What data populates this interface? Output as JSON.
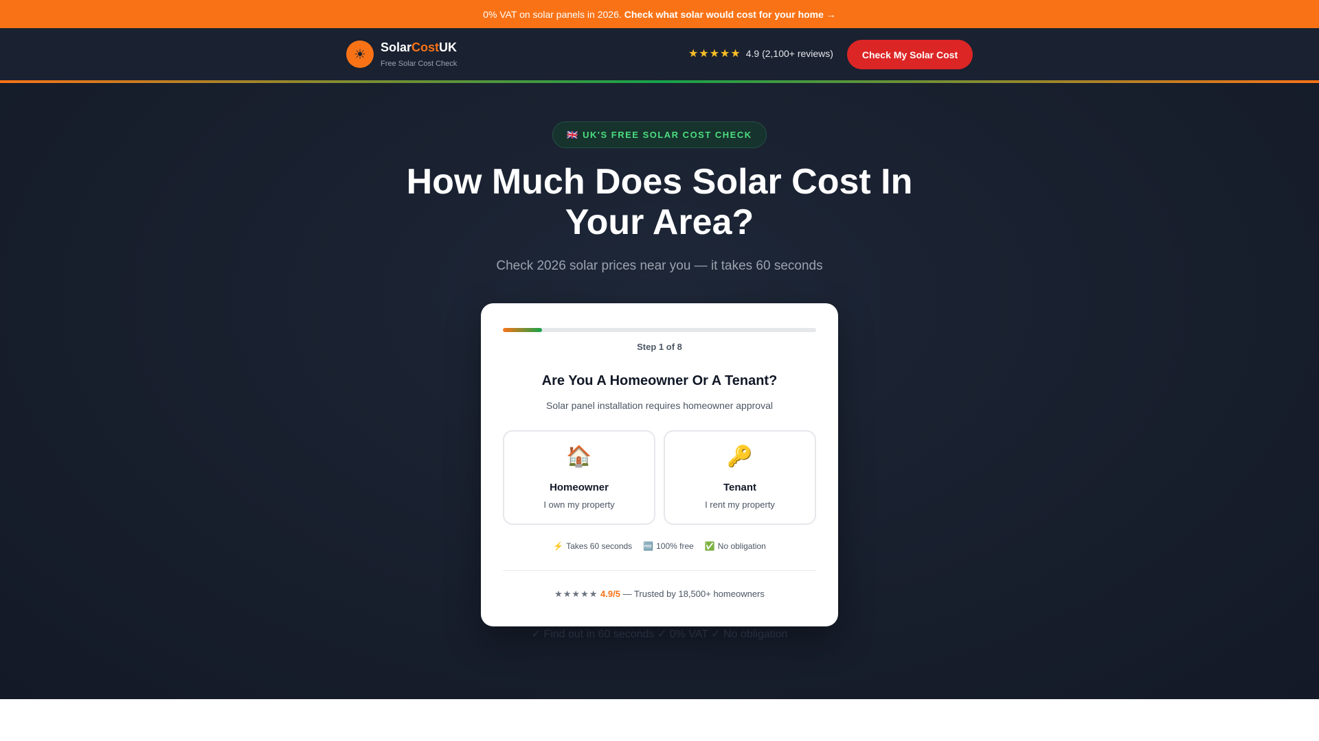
{
  "promo": {
    "text": "0% VAT on solar panels in 2026.",
    "cta": "Check what solar would cost for your home →"
  },
  "header": {
    "logo_icon": "sun-icon",
    "brand_prefix": "Solar",
    "brand_accent": "Cost",
    "brand_suffix": "UK",
    "tagline": "Free Solar Cost Check",
    "rating_stars": "★★★★★",
    "rating_value": 4.9,
    "rating_text": "4.9 (2,100+ reviews)",
    "cta": "Check My Solar Cost"
  },
  "hero": {
    "badge": "🇬🇧 UK'S FREE SOLAR COST CHECK",
    "title": "How Much Does Solar Cost In Your Area?",
    "subtitle": "Check 2026 solar prices near you — it takes 60 seconds",
    "footnote": "✓ Find out in 60 seconds ✓ 0% VAT ✓ No obligation"
  },
  "quiz": {
    "step_current": 1,
    "step_total": 8,
    "progress_fraction": 0.125,
    "step_label": "Step 1 of 8",
    "question": "Are You A Homeowner Or A Tenant?",
    "hint": "Solar panel installation requires homeowner approval",
    "options": [
      {
        "icon": "house-icon",
        "glyph": "🏠",
        "title": "Homeowner",
        "desc": "I own my property"
      },
      {
        "icon": "key-icon",
        "glyph": "🔑",
        "title": "Tenant",
        "desc": "I rent my property"
      }
    ],
    "assurances": [
      {
        "icon": "lightning-icon",
        "glyph": "⚡",
        "text": "Takes 60 seconds"
      },
      {
        "icon": "free-icon",
        "glyph": "🆓",
        "text": "100% free"
      },
      {
        "icon": "check-icon",
        "glyph": "✅",
        "text": "No obligation"
      }
    ],
    "trust_stars": "★★★★★",
    "trust_score": "4.9/5",
    "trust_text": "— Trusted by 18,500+ homeowners"
  },
  "colors": {
    "brand_orange": "#f97316",
    "brand_green": "#16a34a",
    "cta_red": "#dc2626",
    "navy": "#1a2131"
  }
}
